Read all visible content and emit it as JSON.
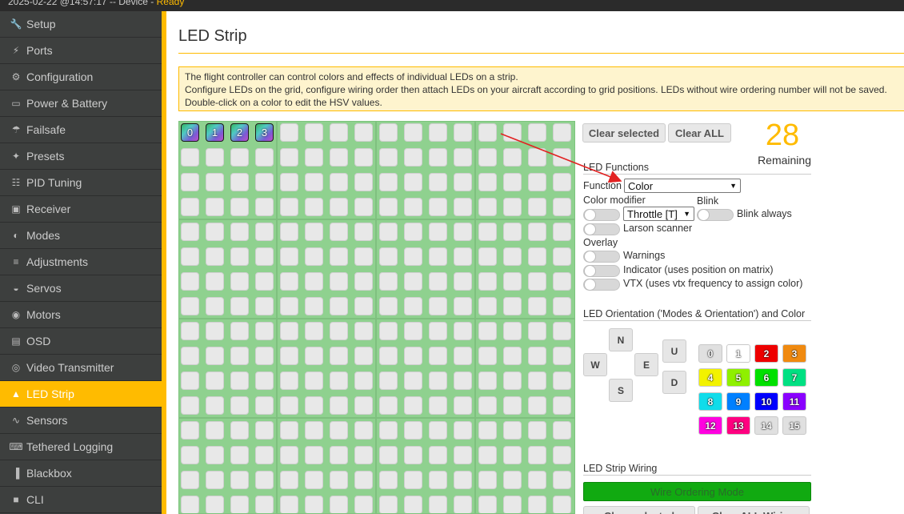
{
  "topbar": {
    "status_text": "2025-02-22 @14:57:17 -- Device - ",
    "ready": "Ready"
  },
  "sidebar": {
    "items": [
      {
        "label": "Setup",
        "icon": "wrench-icon"
      },
      {
        "label": "Ports",
        "icon": "plug-icon"
      },
      {
        "label": "Configuration",
        "icon": "gear-icon"
      },
      {
        "label": "Power & Battery",
        "icon": "battery-icon"
      },
      {
        "label": "Failsafe",
        "icon": "parachute-icon"
      },
      {
        "label": "Presets",
        "icon": "magic-wand-icon"
      },
      {
        "label": "PID Tuning",
        "icon": "sitemap-icon"
      },
      {
        "label": "Receiver",
        "icon": "receiver-icon"
      },
      {
        "label": "Modes",
        "icon": "toggles-icon"
      },
      {
        "label": "Adjustments",
        "icon": "sliders-icon"
      },
      {
        "label": "Servos",
        "icon": "servo-icon"
      },
      {
        "label": "Motors",
        "icon": "motor-icon"
      },
      {
        "label": "OSD",
        "icon": "osd-icon"
      },
      {
        "label": "Video Transmitter",
        "icon": "broadcast-icon"
      },
      {
        "label": "LED Strip",
        "icon": "lightbulb-icon",
        "active": true
      },
      {
        "label": "Sensors",
        "icon": "pulse-icon"
      },
      {
        "label": "Tethered Logging",
        "icon": "keyboard-icon"
      },
      {
        "label": "Blackbox",
        "icon": "barcode-icon"
      },
      {
        "label": "CLI",
        "icon": "terminal-icon"
      }
    ]
  },
  "page": {
    "title": "LED Strip",
    "note_lines": [
      "The flight controller can control colors and effects of individual LEDs on a strip.",
      "Configure LEDs on the grid, configure wiring order then attach LEDs on your aircraft according to grid positions. LEDs without wire ordering number will not be saved.",
      "Double-click on a color to edit the HSV values."
    ]
  },
  "grid": {
    "wired_labels": [
      "0",
      "1",
      "2",
      "3"
    ]
  },
  "controls": {
    "clear_selected": "Clear selected",
    "clear_all": "Clear ALL",
    "remaining_count": "28",
    "remaining_label": "Remaining"
  },
  "functions": {
    "section_title": "LED Functions",
    "function_label": "Function",
    "function_value": "Color",
    "color_modifier_label": "Color modifier",
    "color_modifier_value": "Throttle [T]",
    "blink_label": "Blink",
    "blink_always": "Blink always",
    "larson": "Larson scanner",
    "overlay_label": "Overlay",
    "warnings": "Warnings",
    "indicator": "Indicator (uses position on matrix)",
    "vtx": "VTX (uses vtx frequency to assign color)"
  },
  "orientation": {
    "section_title": "LED Orientation ('Modes & Orientation') and Color",
    "n": "N",
    "w": "W",
    "e": "E",
    "s": "S",
    "u": "U",
    "d": "D",
    "colors": [
      {
        "label": "0",
        "hex": "#e0e0e0"
      },
      {
        "label": "1",
        "hex": "#ffffff"
      },
      {
        "label": "2",
        "hex": "#ee0000"
      },
      {
        "label": "3",
        "hex": "#f08a10"
      },
      {
        "label": "4",
        "hex": "#f2f200"
      },
      {
        "label": "5",
        "hex": "#8ff000"
      },
      {
        "label": "6",
        "hex": "#00e000"
      },
      {
        "label": "7",
        "hex": "#00e082"
      },
      {
        "label": "8",
        "hex": "#10dcea"
      },
      {
        "label": "9",
        "hex": "#0080ff"
      },
      {
        "label": "10",
        "hex": "#0000ff"
      },
      {
        "label": "11",
        "hex": "#8a00ff"
      },
      {
        "label": "12",
        "hex": "#ff00e0"
      },
      {
        "label": "13",
        "hex": "#ff0080"
      },
      {
        "label": "14",
        "hex": "#e0e0e0"
      },
      {
        "label": "15",
        "hex": "#e0e0e0"
      }
    ]
  },
  "wiring": {
    "section_title": "LED Strip Wiring",
    "wire_mode": "Wire Ordering Mode",
    "clear_selected": "Clear selected",
    "clear_all_wiring": "Clear ALL Wiring"
  }
}
